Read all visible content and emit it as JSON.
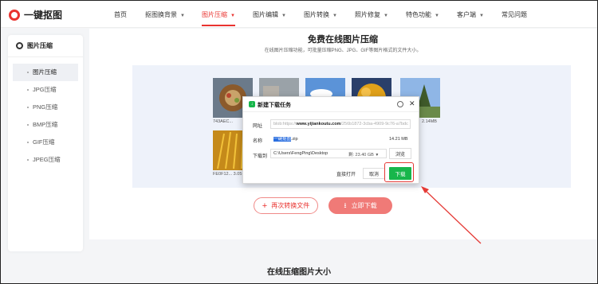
{
  "nav": {
    "logo": "一键抠图",
    "items": [
      {
        "label": "首页",
        "dropdown": false
      },
      {
        "label": "抠图换背景",
        "dropdown": true
      },
      {
        "label": "图片压缩",
        "dropdown": true
      },
      {
        "label": "图片编辑",
        "dropdown": true
      },
      {
        "label": "图片转换",
        "dropdown": true
      },
      {
        "label": "照片修复",
        "dropdown": true
      },
      {
        "label": "特色功能",
        "dropdown": true
      },
      {
        "label": "客户端",
        "dropdown": true
      },
      {
        "label": "常见问题",
        "dropdown": false
      }
    ],
    "active_index": 2
  },
  "sidebar": {
    "title": "图片压缩",
    "items": [
      {
        "label": "图片压缩"
      },
      {
        "label": "JPG压缩"
      },
      {
        "label": "PNG压缩"
      },
      {
        "label": "BMP压缩"
      },
      {
        "label": "GIF压缩"
      },
      {
        "label": "JPEG压缩"
      }
    ],
    "active_index": 0
  },
  "main": {
    "title": "免费在线图片压缩",
    "subtitle": "在线图片压缩功能，可批量压缩PNG、JPG、GIF等图片格式的文件大小。",
    "thumbs": [
      {
        "caption": "743AEC..."
      },
      {
        "caption": "2.14MB"
      },
      {
        "caption": "FE0F12... 3.05"
      }
    ],
    "convert_again": "再次转换文件",
    "download_now": "立即下载"
  },
  "dialog": {
    "title": "新建下载任务",
    "url_label": "网址",
    "url_prefix": "blob:https://",
    "url_domain": "www.yijiankoutu.com",
    "url_rest": "/256b1872-3cba-4909-9c76-a7bdc",
    "name_label": "名称",
    "name_selected": "一键抠图",
    "name_ext": ".zip",
    "file_size": "14.21 MB",
    "save_label": "下载到",
    "save_path": "C:\\Users\\FengPing\\Desktop",
    "free_space": "剩: 23.40 GB",
    "browse": "浏览",
    "open_direct": "直接打开",
    "cancel": "取消",
    "download": "下载"
  },
  "footer": {
    "title": "在线压缩图片大小"
  },
  "colors": {
    "brand_red": "#e9332f",
    "download_green": "#17b64b",
    "annotation_red": "#e53a36"
  }
}
